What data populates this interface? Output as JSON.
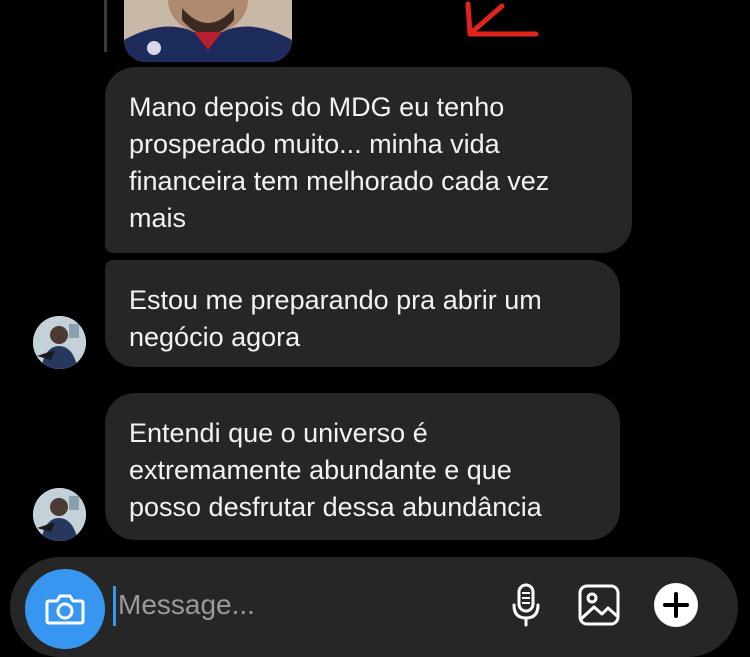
{
  "thread": {
    "messages": [
      {
        "text": "Mano depois do MDG eu tenho\nprosperado muito... minha vida\nfinanceira tem melhorado cada vez\nmais"
      },
      {
        "text": "Estou me preparando pra abrir um\nnegócio agora"
      },
      {
        "text": "Entendi que o universo é\nextremamente abundante e que\nposso desfrutar dessa abundância"
      }
    ]
  },
  "composer": {
    "placeholder": "Message..."
  },
  "icons": {
    "camera": "camera-icon",
    "microphone": "microphone-icon",
    "gallery": "gallery-icon",
    "add": "plus-icon",
    "annotation": "red-arrow-icon"
  },
  "colors": {
    "background": "#000000",
    "bubble": "#262626",
    "accent": "#3797f0",
    "annotation": "#e0231b"
  }
}
